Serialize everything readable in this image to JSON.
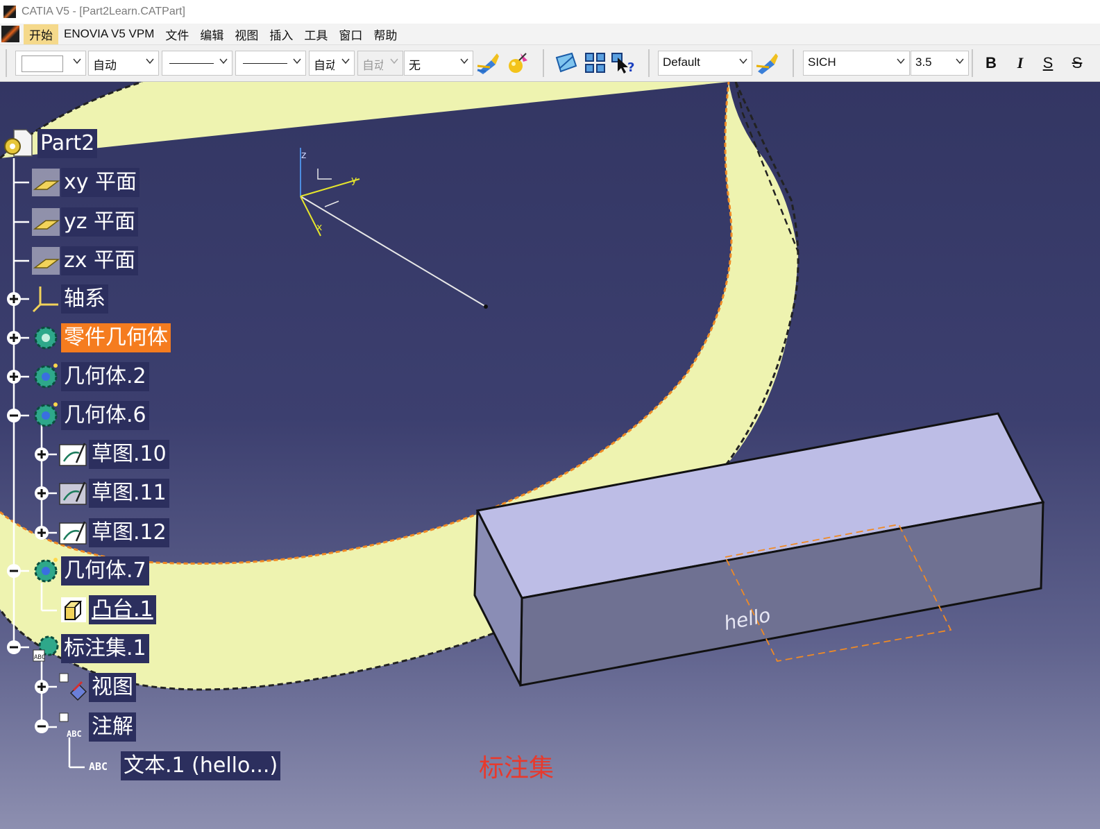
{
  "window": {
    "title": "CATIA V5 - [Part2Learn.CATPart]"
  },
  "menu": {
    "items": [
      "开始",
      "ENOVIA V5 VPM",
      "文件",
      "编辑",
      "视图",
      "插入",
      "工具",
      "窗口",
      "帮助"
    ],
    "active_index": 0
  },
  "toolbar": {
    "color_combo": "",
    "transparency_combo": "自动",
    "linetype_combo": "",
    "linewidth_combo": "",
    "layer_combo_1": "自动",
    "layer_combo_2": "自动",
    "layer_combo_3": "无",
    "style_combo": "Default",
    "font_combo": "SICH",
    "font_size_combo": "3.5",
    "bold": "B",
    "italic": "I",
    "underline": "S",
    "strike": "S"
  },
  "tree": {
    "root": "Part2",
    "nodes": [
      {
        "label": "xy 平面"
      },
      {
        "label": "yz 平面"
      },
      {
        "label": "zx 平面"
      },
      {
        "label": "轴系"
      },
      {
        "label": "零件几何体"
      },
      {
        "label": "几何体.2"
      },
      {
        "label": "几何体.6"
      },
      {
        "label": "草图.10"
      },
      {
        "label": "草图.11"
      },
      {
        "label": "草图.12"
      },
      {
        "label": "几何体.7"
      },
      {
        "label": "凸台.1"
      },
      {
        "label": "标注集.1"
      },
      {
        "label": "视图"
      },
      {
        "label": "注解"
      },
      {
        "label": "文本.1 (hello...)"
      }
    ]
  },
  "scene": {
    "annotation_text": "hello",
    "axis_labels": {
      "z": "z",
      "y": "y",
      "x": "x"
    }
  },
  "caption": "标注集",
  "colors": {
    "background_top": "#333663",
    "background_bottom": "#8d8fb0",
    "ring_fill": "#eef3b0",
    "box_top": "#bdbde6",
    "box_front": "#6f7192",
    "selection": "#f57c1f",
    "caption": "#e8392c"
  }
}
